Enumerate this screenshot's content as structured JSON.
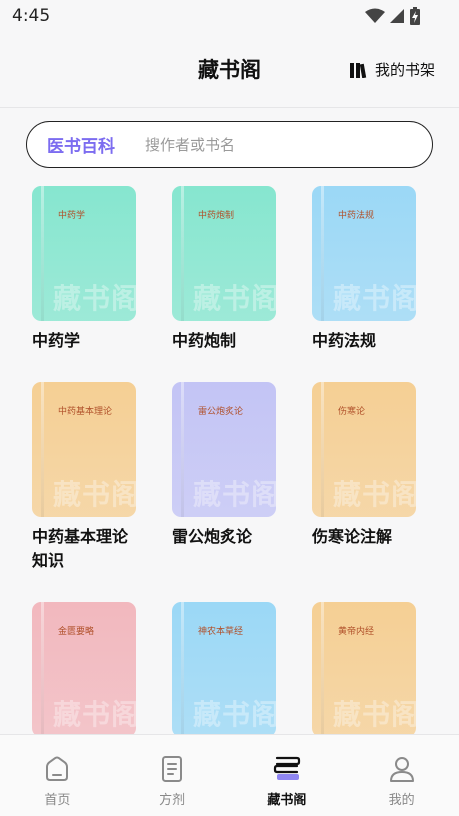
{
  "status": {
    "time": "4:45"
  },
  "header": {
    "title": "藏书阁",
    "shelf_label": "我的书架"
  },
  "search": {
    "category": "医书百科",
    "placeholder": "搜作者或书名",
    "value": ""
  },
  "watermark_text": "藏书阁",
  "books": [
    {
      "name": "中药学",
      "cover_title": "中药学",
      "color": "#86e6cf"
    },
    {
      "name": "中药炮制",
      "cover_title": "中药炮制",
      "color": "#86e6cf"
    },
    {
      "name": "中药法规",
      "cover_title": "中药法规",
      "color": "#9bd8f6"
    },
    {
      "name": "中药基本理论知识",
      "cover_title": "中药基本理论",
      "color": "#f5cf94"
    },
    {
      "name": "雷公炮炙论",
      "cover_title": "雷公炮炙论",
      "color": "#c3c4f5"
    },
    {
      "name": "伤寒论注解",
      "cover_title": "伤寒论",
      "color": "#f5cf94"
    },
    {
      "name": "",
      "cover_title": "金匮要略",
      "color": "#f2b8be"
    },
    {
      "name": "",
      "cover_title": "神农本草经",
      "color": "#9bd8f6"
    },
    {
      "name": "",
      "cover_title": "黄帝内经",
      "color": "#f5cf94"
    }
  ],
  "nav": [
    {
      "label": "首页",
      "icon": "home-icon",
      "active": false
    },
    {
      "label": "方剂",
      "icon": "prescription-icon",
      "active": false
    },
    {
      "label": "藏书阁",
      "icon": "library-icon",
      "active": true
    },
    {
      "label": "我的",
      "icon": "profile-icon",
      "active": false
    }
  ]
}
